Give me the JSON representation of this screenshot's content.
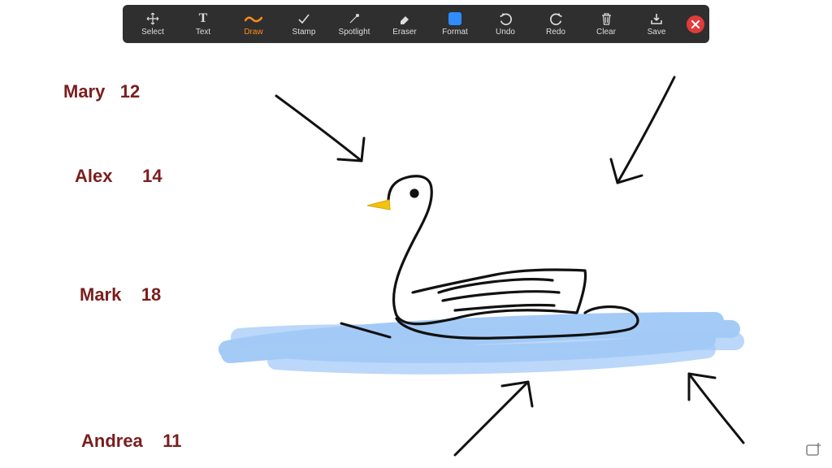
{
  "toolbar": {
    "select": "Select",
    "text": "Text",
    "draw": "Draw",
    "stamp": "Stamp",
    "spotlight": "Spotlight",
    "eraser": "Eraser",
    "format": "Format",
    "undo": "Undo",
    "redo": "Redo",
    "clear": "Clear",
    "save": "Save",
    "active_tool": "draw"
  },
  "notes": [
    {
      "name": "Mary",
      "value": "12"
    },
    {
      "name": "Alex",
      "value": "14"
    },
    {
      "name": "Mark",
      "value": "18"
    },
    {
      "name": "Andrea",
      "value": "11"
    }
  ],
  "colors": {
    "text_color": "#7a1e1e",
    "water_color": "#5a9ff0",
    "accent_orange": "#ff8c1a",
    "format_blue": "#2e8cff"
  }
}
